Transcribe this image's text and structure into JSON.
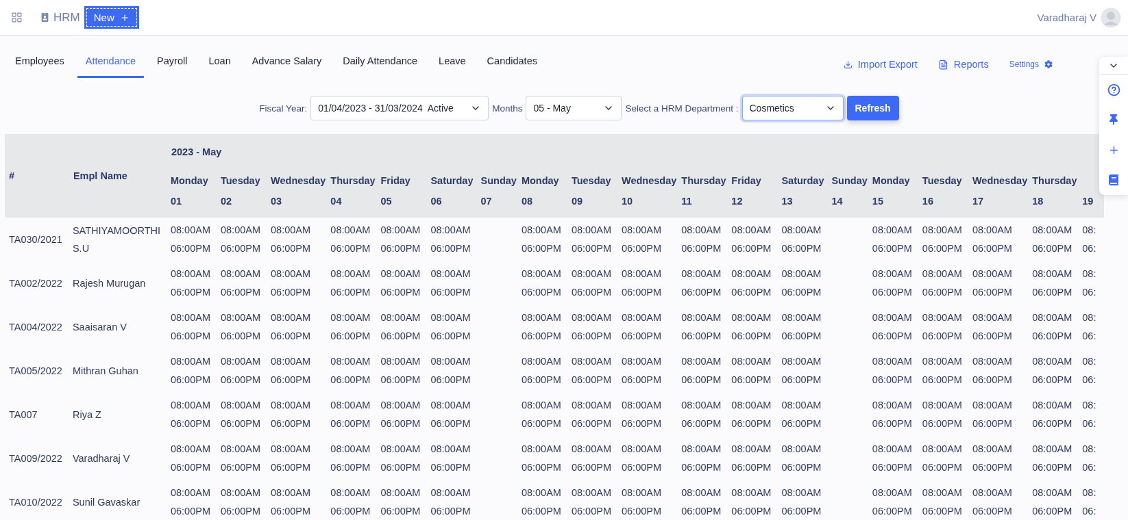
{
  "app": {
    "module": "HRM",
    "new_button": "New",
    "user": "Varadharaj V"
  },
  "tabs": [
    {
      "label": "Employees",
      "selected": false
    },
    {
      "label": "Attendance",
      "selected": true
    },
    {
      "label": "Payroll",
      "selected": false
    },
    {
      "label": "Loan",
      "selected": false
    },
    {
      "label": "Advance Salary",
      "selected": false
    },
    {
      "label": "Daily Attendance",
      "selected": false
    },
    {
      "label": "Leave",
      "selected": false
    },
    {
      "label": "Candidates",
      "selected": false
    }
  ],
  "actions": [
    {
      "kind": "import",
      "label": "Import Export"
    },
    {
      "kind": "reports",
      "label": "Reports"
    },
    {
      "kind": "settings",
      "label": "Settings"
    }
  ],
  "filters": [
    {
      "label": "Fiscal Year:",
      "value": "01/04/2023 - 31/03/2024  Active",
      "focused": false
    },
    {
      "label": "Months",
      "value": "05 - May",
      "focused": false
    },
    {
      "label": "Select a HRM Department :",
      "value": "Cosmetics",
      "focused": true
    }
  ],
  "refresh_button": "Refresh",
  "table": {
    "id_header": "#",
    "name_header": "Empl Name",
    "period": "2023 - May",
    "days": [
      {
        "weekday": "Monday",
        "date": "01"
      },
      {
        "weekday": "Tuesday",
        "date": "02"
      },
      {
        "weekday": "Wednesday",
        "date": "03"
      },
      {
        "weekday": "Thursday",
        "date": "04"
      },
      {
        "weekday": "Friday",
        "date": "05"
      },
      {
        "weekday": "Saturday",
        "date": "06"
      },
      {
        "weekday": "Sunday",
        "date": "07"
      },
      {
        "weekday": "Monday",
        "date": "08"
      },
      {
        "weekday": "Tuesday",
        "date": "09"
      },
      {
        "weekday": "Wednesday",
        "date": "10"
      },
      {
        "weekday": "Thursday",
        "date": "11"
      },
      {
        "weekday": "Friday",
        "date": "12"
      },
      {
        "weekday": "Saturday",
        "date": "13"
      },
      {
        "weekday": "Sunday",
        "date": "14"
      },
      {
        "weekday": "Monday",
        "date": "15"
      },
      {
        "weekday": "Tuesday",
        "date": "16"
      },
      {
        "weekday": "Wednesday",
        "date": "17"
      },
      {
        "weekday": "Thursday",
        "date": "18"
      },
      {
        "date": "19"
      }
    ],
    "rows": [
      {
        "id": "TA030/2021",
        "name": "SATHIYAMOORTHI S.U",
        "times": [
          {
            "kind": "shift",
            "in": "08:00AM",
            "out": "06:00PM"
          },
          {
            "kind": "shift",
            "in": "08:00AM",
            "out": "06:00PM"
          },
          {
            "kind": "shift",
            "in": "08:00AM",
            "out": "06:00PM"
          },
          {
            "kind": "shift",
            "in": "08:00AM",
            "out": "06:00PM"
          },
          {
            "kind": "shift",
            "in": "08:00AM",
            "out": "06:00PM"
          },
          {
            "kind": "shift",
            "in": "08:00AM",
            "out": "06:00PM"
          },
          {
            "kind": "off"
          },
          {
            "kind": "shift",
            "in": "08:00AM",
            "out": "06:00PM"
          },
          {
            "kind": "shift",
            "in": "08:00AM",
            "out": "06:00PM"
          },
          {
            "kind": "shift",
            "in": "08:00AM",
            "out": "06:00PM"
          },
          {
            "kind": "shift",
            "in": "08:00AM",
            "out": "06:00PM"
          },
          {
            "kind": "shift",
            "in": "08:00AM",
            "out": "06:00PM"
          },
          {
            "kind": "shift",
            "in": "08:00AM",
            "out": "06:00PM"
          },
          {
            "kind": "off"
          },
          {
            "kind": "shift",
            "in": "08:00AM",
            "out": "06:00PM"
          },
          {
            "kind": "shift",
            "in": "08:00AM",
            "out": "06:00PM"
          },
          {
            "kind": "shift",
            "in": "08:00AM",
            "out": "06:00PM"
          },
          {
            "kind": "shift",
            "in": "08:00AM",
            "out": "06:00PM"
          },
          {
            "kind": "shift",
            "in": "08:",
            "out": "06:"
          }
        ]
      },
      {
        "id": "TA002/2022",
        "name": "Rajesh Murugan",
        "times": [
          {
            "kind": "shift",
            "in": "08:00AM",
            "out": "06:00PM"
          },
          {
            "kind": "shift",
            "in": "08:00AM",
            "out": "06:00PM"
          },
          {
            "kind": "shift",
            "in": "08:00AM",
            "out": "06:00PM"
          },
          {
            "kind": "shift",
            "in": "08:00AM",
            "out": "06:00PM"
          },
          {
            "kind": "shift",
            "in": "08:00AM",
            "out": "06:00PM"
          },
          {
            "kind": "shift",
            "in": "08:00AM",
            "out": "06:00PM"
          },
          {
            "kind": "off"
          },
          {
            "kind": "shift",
            "in": "08:00AM",
            "out": "06:00PM"
          },
          {
            "kind": "shift",
            "in": "08:00AM",
            "out": "06:00PM"
          },
          {
            "kind": "shift",
            "in": "08:00AM",
            "out": "06:00PM"
          },
          {
            "kind": "shift",
            "in": "08:00AM",
            "out": "06:00PM"
          },
          {
            "kind": "shift",
            "in": "08:00AM",
            "out": "06:00PM"
          },
          {
            "kind": "shift",
            "in": "08:00AM",
            "out": "06:00PM"
          },
          {
            "kind": "off"
          },
          {
            "kind": "shift",
            "in": "08:00AM",
            "out": "06:00PM"
          },
          {
            "kind": "shift",
            "in": "08:00AM",
            "out": "06:00PM"
          },
          {
            "kind": "shift",
            "in": "08:00AM",
            "out": "06:00PM"
          },
          {
            "kind": "shift",
            "in": "08:00AM",
            "out": "06:00PM"
          },
          {
            "kind": "shift",
            "in": "08:",
            "out": "06:"
          }
        ]
      },
      {
        "id": "TA004/2022",
        "name": "Saaisaran V",
        "times": [
          {
            "kind": "shift",
            "in": "08:00AM",
            "out": "06:00PM"
          },
          {
            "kind": "shift",
            "in": "08:00AM",
            "out": "06:00PM"
          },
          {
            "kind": "shift",
            "in": "08:00AM",
            "out": "06:00PM"
          },
          {
            "kind": "shift",
            "in": "08:00AM",
            "out": "06:00PM"
          },
          {
            "kind": "shift",
            "in": "08:00AM",
            "out": "06:00PM"
          },
          {
            "kind": "shift",
            "in": "08:00AM",
            "out": "06:00PM"
          },
          {
            "kind": "off"
          },
          {
            "kind": "shift",
            "in": "08:00AM",
            "out": "06:00PM"
          },
          {
            "kind": "shift",
            "in": "08:00AM",
            "out": "06:00PM"
          },
          {
            "kind": "shift",
            "in": "08:00AM",
            "out": "06:00PM"
          },
          {
            "kind": "shift",
            "in": "08:00AM",
            "out": "06:00PM"
          },
          {
            "kind": "shift",
            "in": "08:00AM",
            "out": "06:00PM"
          },
          {
            "kind": "shift",
            "in": "08:00AM",
            "out": "06:00PM"
          },
          {
            "kind": "off"
          },
          {
            "kind": "shift",
            "in": "08:00AM",
            "out": "06:00PM"
          },
          {
            "kind": "shift",
            "in": "08:00AM",
            "out": "06:00PM"
          },
          {
            "kind": "shift",
            "in": "08:00AM",
            "out": "06:00PM"
          },
          {
            "kind": "shift",
            "in": "08:00AM",
            "out": "06:00PM"
          },
          {
            "kind": "shift",
            "in": "08:",
            "out": "06:"
          }
        ]
      },
      {
        "id": "TA005/2022",
        "name": "Mithran Guhan",
        "times": [
          {
            "kind": "shift",
            "in": "08:00AM",
            "out": "06:00PM"
          },
          {
            "kind": "shift",
            "in": "08:00AM",
            "out": "06:00PM"
          },
          {
            "kind": "shift",
            "in": "08:00AM",
            "out": "06:00PM"
          },
          {
            "kind": "shift",
            "in": "08:00AM",
            "out": "06:00PM"
          },
          {
            "kind": "shift",
            "in": "08:00AM",
            "out": "06:00PM"
          },
          {
            "kind": "shift",
            "in": "08:00AM",
            "out": "06:00PM"
          },
          {
            "kind": "off"
          },
          {
            "kind": "shift",
            "in": "08:00AM",
            "out": "06:00PM"
          },
          {
            "kind": "shift",
            "in": "08:00AM",
            "out": "06:00PM"
          },
          {
            "kind": "shift",
            "in": "08:00AM",
            "out": "06:00PM"
          },
          {
            "kind": "shift",
            "in": "08:00AM",
            "out": "06:00PM"
          },
          {
            "kind": "shift",
            "in": "08:00AM",
            "out": "06:00PM"
          },
          {
            "kind": "shift",
            "in": "08:00AM",
            "out": "06:00PM"
          },
          {
            "kind": "off"
          },
          {
            "kind": "shift",
            "in": "08:00AM",
            "out": "06:00PM"
          },
          {
            "kind": "shift",
            "in": "08:00AM",
            "out": "06:00PM"
          },
          {
            "kind": "shift",
            "in": "08:00AM",
            "out": "06:00PM"
          },
          {
            "kind": "shift",
            "in": "08:00AM",
            "out": "06:00PM"
          },
          {
            "kind": "shift",
            "in": "08:",
            "out": "06:"
          }
        ]
      },
      {
        "id": "TA007",
        "name": "Riya Z",
        "times": [
          {
            "kind": "shift",
            "in": "08:00AM",
            "out": "06:00PM"
          },
          {
            "kind": "shift",
            "in": "08:00AM",
            "out": "06:00PM"
          },
          {
            "kind": "shift",
            "in": "08:00AM",
            "out": "06:00PM"
          },
          {
            "kind": "shift",
            "in": "08:00AM",
            "out": "06:00PM"
          },
          {
            "kind": "shift",
            "in": "08:00AM",
            "out": "06:00PM"
          },
          {
            "kind": "shift",
            "in": "08:00AM",
            "out": "06:00PM"
          },
          {
            "kind": "off"
          },
          {
            "kind": "shift",
            "in": "08:00AM",
            "out": "06:00PM"
          },
          {
            "kind": "shift",
            "in": "08:00AM",
            "out": "06:00PM"
          },
          {
            "kind": "shift",
            "in": "08:00AM",
            "out": "06:00PM"
          },
          {
            "kind": "shift",
            "in": "08:00AM",
            "out": "06:00PM"
          },
          {
            "kind": "shift",
            "in": "08:00AM",
            "out": "06:00PM"
          },
          {
            "kind": "shift",
            "in": "08:00AM",
            "out": "06:00PM"
          },
          {
            "kind": "off"
          },
          {
            "kind": "shift",
            "in": "08:00AM",
            "out": "06:00PM"
          },
          {
            "kind": "shift",
            "in": "08:00AM",
            "out": "06:00PM"
          },
          {
            "kind": "shift",
            "in": "08:00AM",
            "out": "06:00PM"
          },
          {
            "kind": "shift",
            "in": "08:00AM",
            "out": "06:00PM"
          },
          {
            "kind": "shift",
            "in": "08:",
            "out": "06:"
          }
        ]
      },
      {
        "id": "TA009/2022",
        "name": "Varadharaj V",
        "times": [
          {
            "kind": "shift",
            "in": "08:00AM",
            "out": "06:00PM"
          },
          {
            "kind": "shift",
            "in": "08:00AM",
            "out": "06:00PM"
          },
          {
            "kind": "shift",
            "in": "08:00AM",
            "out": "06:00PM"
          },
          {
            "kind": "shift",
            "in": "08:00AM",
            "out": "06:00PM"
          },
          {
            "kind": "shift",
            "in": "08:00AM",
            "out": "06:00PM"
          },
          {
            "kind": "shift",
            "in": "08:00AM",
            "out": "06:00PM"
          },
          {
            "kind": "off"
          },
          {
            "kind": "shift",
            "in": "08:00AM",
            "out": "06:00PM"
          },
          {
            "kind": "shift",
            "in": "08:00AM",
            "out": "06:00PM"
          },
          {
            "kind": "shift",
            "in": "08:00AM",
            "out": "06:00PM"
          },
          {
            "kind": "shift",
            "in": "08:00AM",
            "out": "06:00PM"
          },
          {
            "kind": "shift",
            "in": "08:00AM",
            "out": "06:00PM"
          },
          {
            "kind": "shift",
            "in": "08:00AM",
            "out": "06:00PM"
          },
          {
            "kind": "off"
          },
          {
            "kind": "shift",
            "in": "08:00AM",
            "out": "06:00PM"
          },
          {
            "kind": "shift",
            "in": "08:00AM",
            "out": "06:00PM"
          },
          {
            "kind": "shift",
            "in": "08:00AM",
            "out": "06:00PM"
          },
          {
            "kind": "shift",
            "in": "08:00AM",
            "out": "06:00PM"
          },
          {
            "kind": "shift",
            "in": "08:",
            "out": "06:"
          }
        ]
      },
      {
        "id": "TA010/2022",
        "name": "Sunil Gavaskar",
        "times": [
          {
            "kind": "shift",
            "in": "08:00AM",
            "out": "06:00PM"
          },
          {
            "kind": "shift",
            "in": "08:00AM",
            "out": "06:00PM"
          },
          {
            "kind": "shift",
            "in": "08:00AM",
            "out": "06:00PM"
          },
          {
            "kind": "shift",
            "in": "08:00AM",
            "out": "06:00PM"
          },
          {
            "kind": "shift",
            "in": "08:00AM",
            "out": "06:00PM"
          },
          {
            "kind": "shift",
            "in": "08:00AM",
            "out": "06:00PM"
          },
          {
            "kind": "off"
          },
          {
            "kind": "shift",
            "in": "08:00AM",
            "out": "06:00PM"
          },
          {
            "kind": "shift",
            "in": "08:00AM",
            "out": "06:00PM"
          },
          {
            "kind": "shift",
            "in": "08:00AM",
            "out": "06:00PM"
          },
          {
            "kind": "shift",
            "in": "08:00AM",
            "out": "06:00PM"
          },
          {
            "kind": "shift",
            "in": "08:00AM",
            "out": "06:00PM"
          },
          {
            "kind": "shift",
            "in": "08:00AM",
            "out": "06:00PM"
          },
          {
            "kind": "off"
          },
          {
            "kind": "shift",
            "in": "08:00AM",
            "out": "06:00PM"
          },
          {
            "kind": "shift",
            "in": "08:00AM",
            "out": "06:00PM"
          },
          {
            "kind": "shift",
            "in": "08:00AM",
            "out": "06:00PM"
          },
          {
            "kind": "shift",
            "in": "08:00AM",
            "out": "06:00PM"
          },
          {
            "kind": "shift",
            "in": "08:",
            "out": "06:"
          }
        ]
      }
    ]
  }
}
